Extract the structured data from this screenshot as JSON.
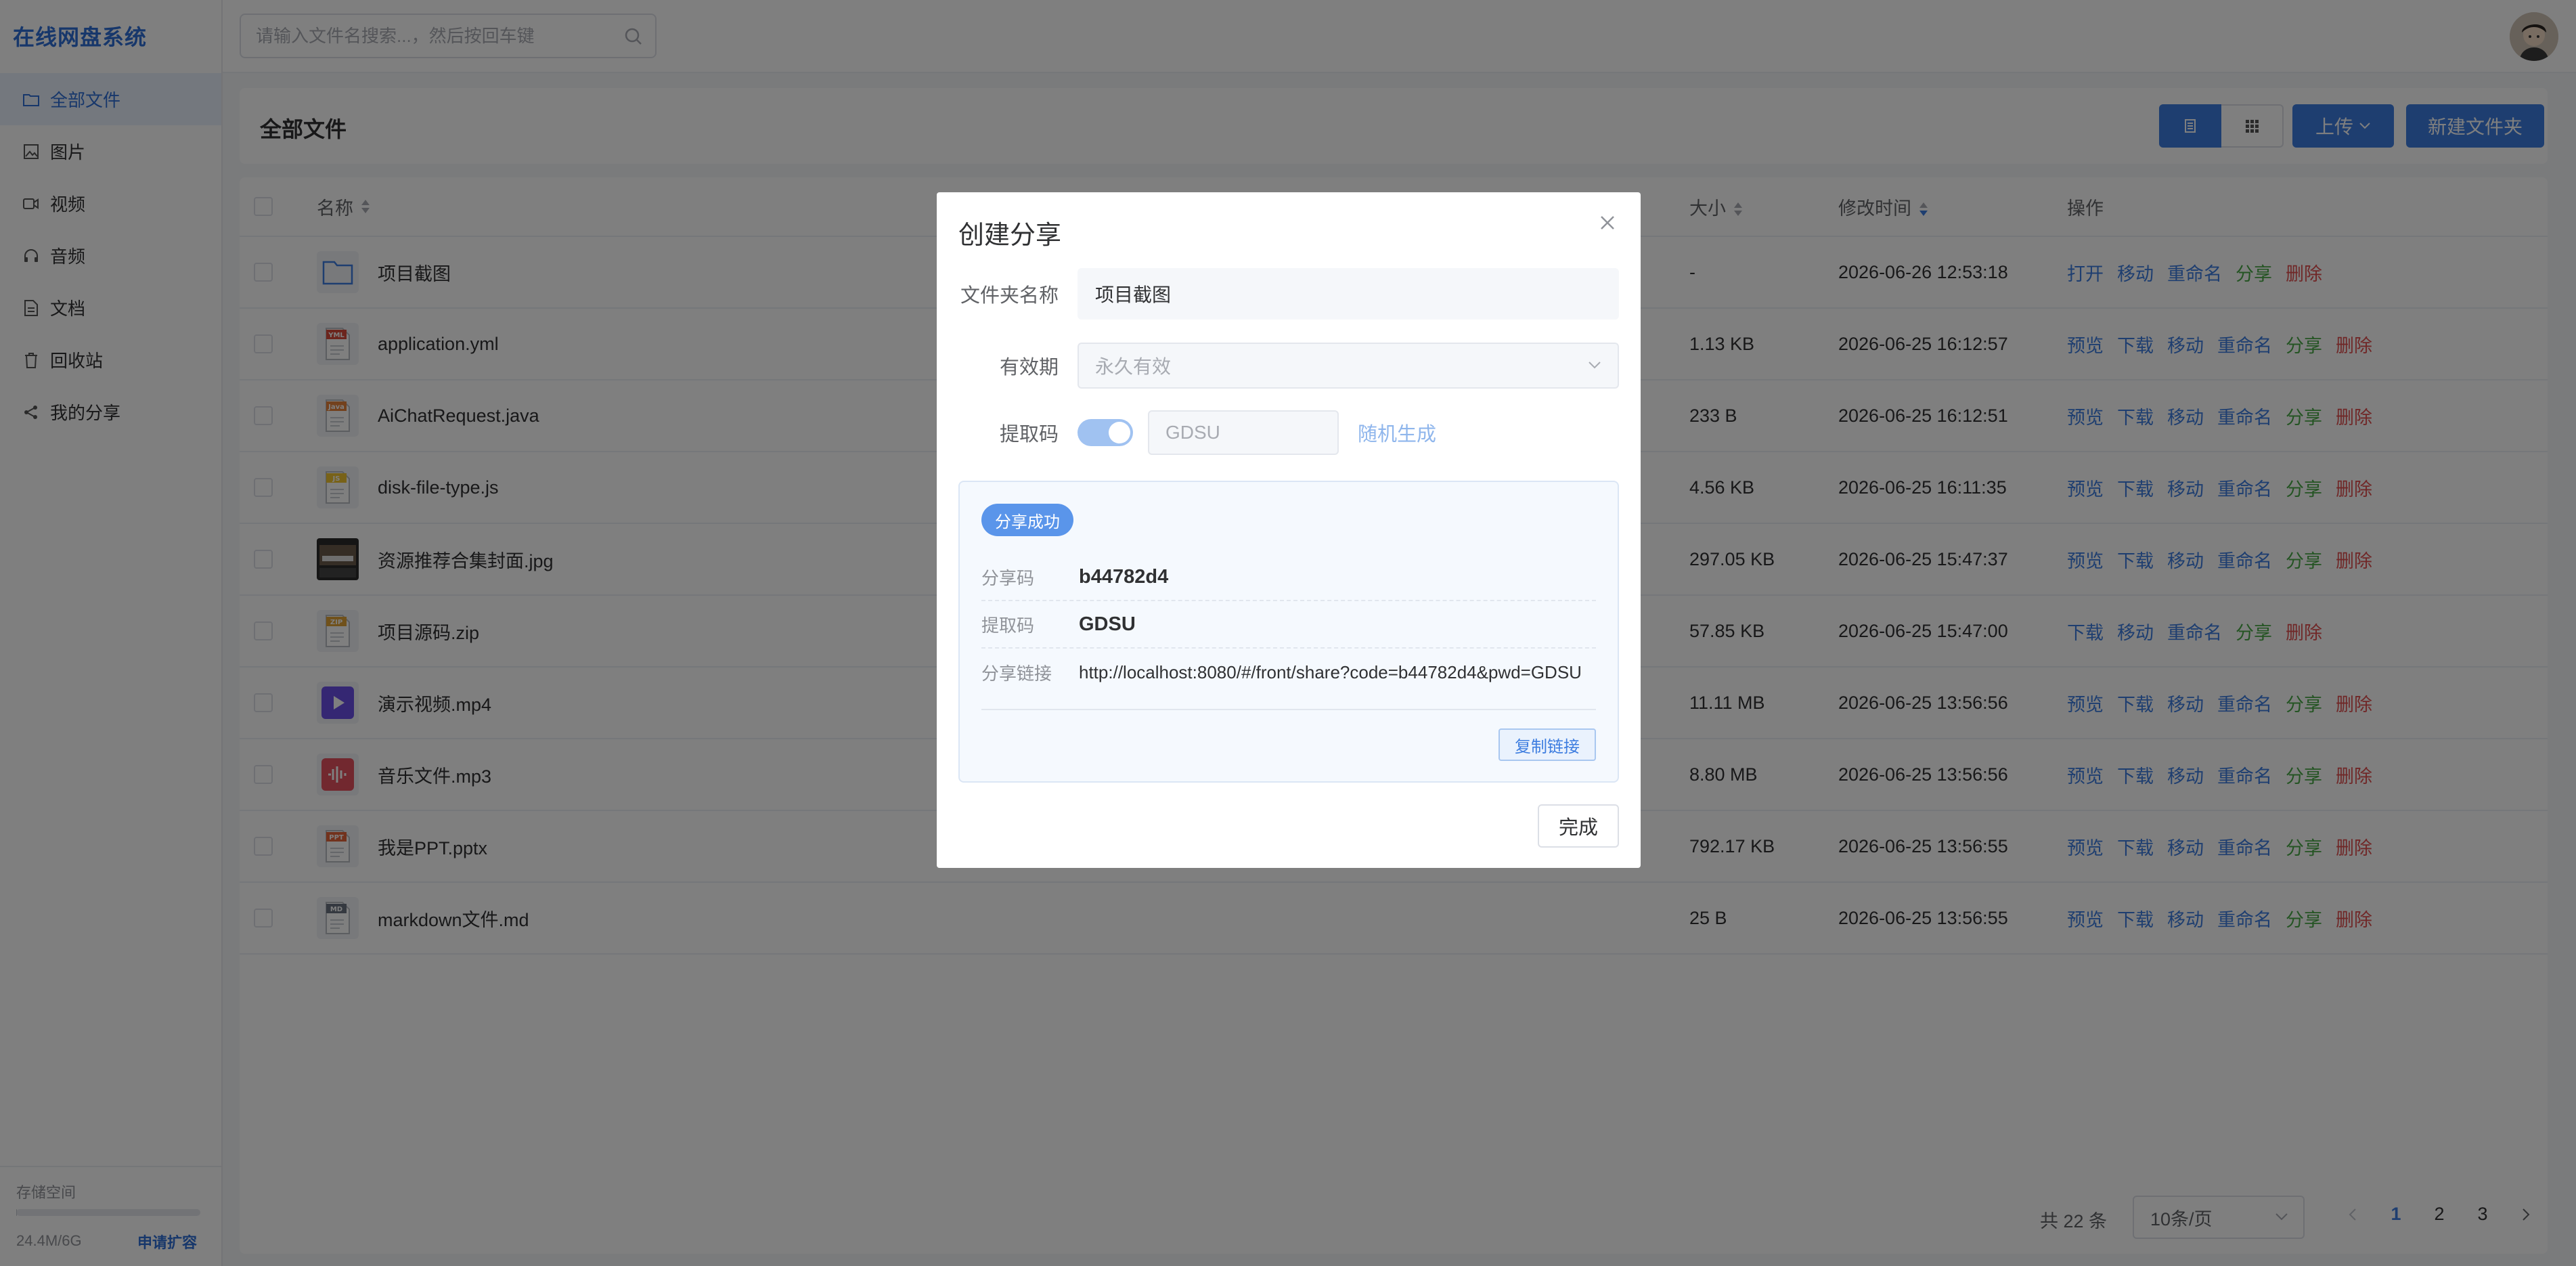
{
  "app": {
    "title": "在线网盘系统"
  },
  "sidebar": {
    "items": [
      {
        "label": "全部文件",
        "icon": "folder-icon",
        "active": true
      },
      {
        "label": "图片",
        "icon": "image-icon",
        "active": false
      },
      {
        "label": "视频",
        "icon": "video-icon",
        "active": false
      },
      {
        "label": "音频",
        "icon": "headphones-icon",
        "active": false
      },
      {
        "label": "文档",
        "icon": "document-icon",
        "active": false
      },
      {
        "label": "回收站",
        "icon": "trash-icon",
        "active": false
      },
      {
        "label": "我的分享",
        "icon": "share-icon",
        "active": false
      }
    ],
    "storage": {
      "title": "存储空间",
      "used": "24.4M/6G",
      "apply_label": "申请扩容",
      "fraction": 0.004
    }
  },
  "header": {
    "search_placeholder": "请输入文件名搜索...，然后按回车键"
  },
  "toolbar": {
    "title": "全部文件",
    "upload_label": "上传",
    "new_folder_label": "新建文件夹"
  },
  "table": {
    "headers": {
      "name": "名称",
      "size": "大小",
      "time": "修改时间",
      "ops": "操作"
    },
    "rows": [
      {
        "name": "项目截图",
        "type": "folder",
        "size": "-",
        "time": "2026-06-26 12:53:18",
        "ops": [
          "打开",
          "移动",
          "重命名",
          "分享",
          "删除"
        ]
      },
      {
        "name": "application.yml",
        "type": "yml",
        "size": "1.13 KB",
        "time": "2026-06-25 16:12:57",
        "ops": [
          "预览",
          "下载",
          "移动",
          "重命名",
          "分享",
          "删除"
        ]
      },
      {
        "name": "AiChatRequest.java",
        "type": "java",
        "size": "233 B",
        "time": "2026-06-25 16:12:51",
        "ops": [
          "预览",
          "下载",
          "移动",
          "重命名",
          "分享",
          "删除"
        ]
      },
      {
        "name": "disk-file-type.js",
        "type": "js",
        "size": "4.56 KB",
        "time": "2026-06-25 16:11:35",
        "ops": [
          "预览",
          "下载",
          "移动",
          "重命名",
          "分享",
          "删除"
        ]
      },
      {
        "name": "资源推荐合集封面.jpg",
        "type": "jpg",
        "size": "297.05 KB",
        "time": "2026-06-25 15:47:37",
        "ops": [
          "预览",
          "下载",
          "移动",
          "重命名",
          "分享",
          "删除"
        ]
      },
      {
        "name": "项目源码.zip",
        "type": "zip",
        "size": "57.85 KB",
        "time": "2026-06-25 15:47:00",
        "ops": [
          "下载",
          "移动",
          "重命名",
          "分享",
          "删除"
        ]
      },
      {
        "name": "演示视频.mp4",
        "type": "mp4",
        "size": "11.11 MB",
        "time": "2026-06-25 13:56:56",
        "ops": [
          "预览",
          "下载",
          "移动",
          "重命名",
          "分享",
          "删除"
        ]
      },
      {
        "name": "音乐文件.mp3",
        "type": "mp3",
        "size": "8.80 MB",
        "time": "2026-06-25 13:56:56",
        "ops": [
          "预览",
          "下载",
          "移动",
          "重命名",
          "分享",
          "删除"
        ]
      },
      {
        "name": "我是PPT.pptx",
        "type": "ppt",
        "size": "792.17 KB",
        "time": "2026-06-25 13:56:55",
        "ops": [
          "预览",
          "下载",
          "移动",
          "重命名",
          "分享",
          "删除"
        ]
      },
      {
        "name": "markdown文件.md",
        "type": "md",
        "size": "25 B",
        "time": "2026-06-25 13:56:55",
        "ops": [
          "预览",
          "下载",
          "移动",
          "重命名",
          "分享",
          "删除"
        ]
      }
    ],
    "file_badges": {
      "yml": "YML",
      "java": "Java",
      "js": "JS",
      "zip": "ZIP",
      "ppt": "PPT",
      "md": "MD"
    }
  },
  "pagination": {
    "total": "共 22 条",
    "page_size": "10条/页",
    "pages": [
      "1",
      "2",
      "3"
    ],
    "current": "1"
  },
  "dialog": {
    "title": "创建分享",
    "folder_label": "文件夹名称",
    "folder_value": "项目截图",
    "expiry_label": "有效期",
    "expiry_value": "永久有效",
    "code_label": "提取码",
    "code_value": "GDSU",
    "random_label": "随机生成",
    "success_badge": "分享成功",
    "share_code_label": "分享码",
    "share_code_value": "b44782d4",
    "extract_code_label": "提取码",
    "extract_code_value": "GDSU",
    "link_label": "分享链接",
    "link_value": "http://localhost:8080/#/front/share?code=b44782d4&pwd=GDSU",
    "copy_label": "复制链接",
    "done_label": "完成"
  },
  "colors": {
    "accent": "#3d7de0",
    "green": "#48a946",
    "red": "#e04f4f"
  }
}
